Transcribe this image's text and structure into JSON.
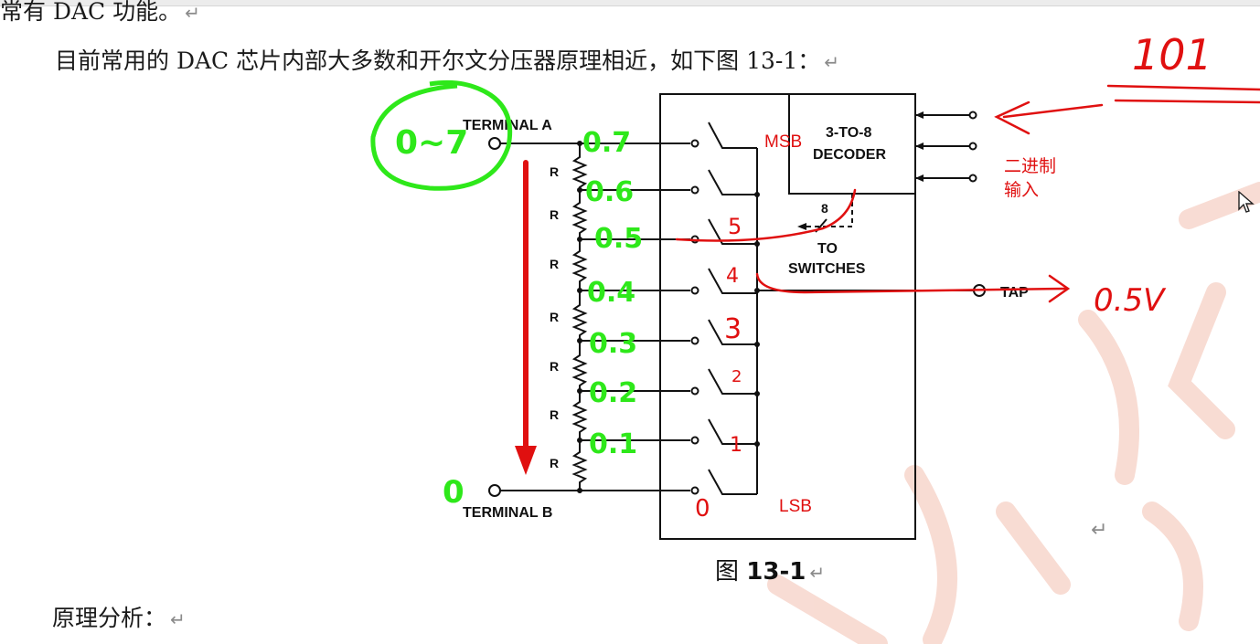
{
  "doc": {
    "line_top": "常有 DAC 功能。",
    "line_intro": "目前常用的 DAC 芯片内部大多数和开尔文分压器原理相近，如下图 13-1：",
    "caption_prefix": "图",
    "caption_number": "13-1",
    "line_analysis": "原理分析：",
    "return_mark": "↵"
  },
  "diagram": {
    "terminal_a": "TERMINAL A",
    "terminal_b": "TERMINAL B",
    "resistor_label": "R",
    "decoder_line1": "3-TO-8",
    "decoder_line2": "DECODER",
    "bus_width": "8",
    "to_label": "TO",
    "switches_label": "SWITCHES",
    "tap_label": "TAP",
    "msb_label": "MSB",
    "lsb_label": "LSB",
    "binary_input_line1": "二进制",
    "binary_input_line2": "输入"
  },
  "annotations": {
    "binary_code": "101",
    "top_voltage": "0~7",
    "bottom_voltage": "0",
    "tap_voltage": "0.5V",
    "node_voltages": [
      "0.7",
      "0.6",
      "0.5",
      "0.4",
      "0.3",
      "0.2",
      "0.1"
    ],
    "switch_numbers": [
      "5",
      "4",
      "3",
      "2",
      "1",
      "0"
    ]
  },
  "colors": {
    "annotation_red": "#e01010",
    "annotation_green": "#2ee81a",
    "diagram_ink": "#111111",
    "watermark": "#f7d6cc"
  }
}
